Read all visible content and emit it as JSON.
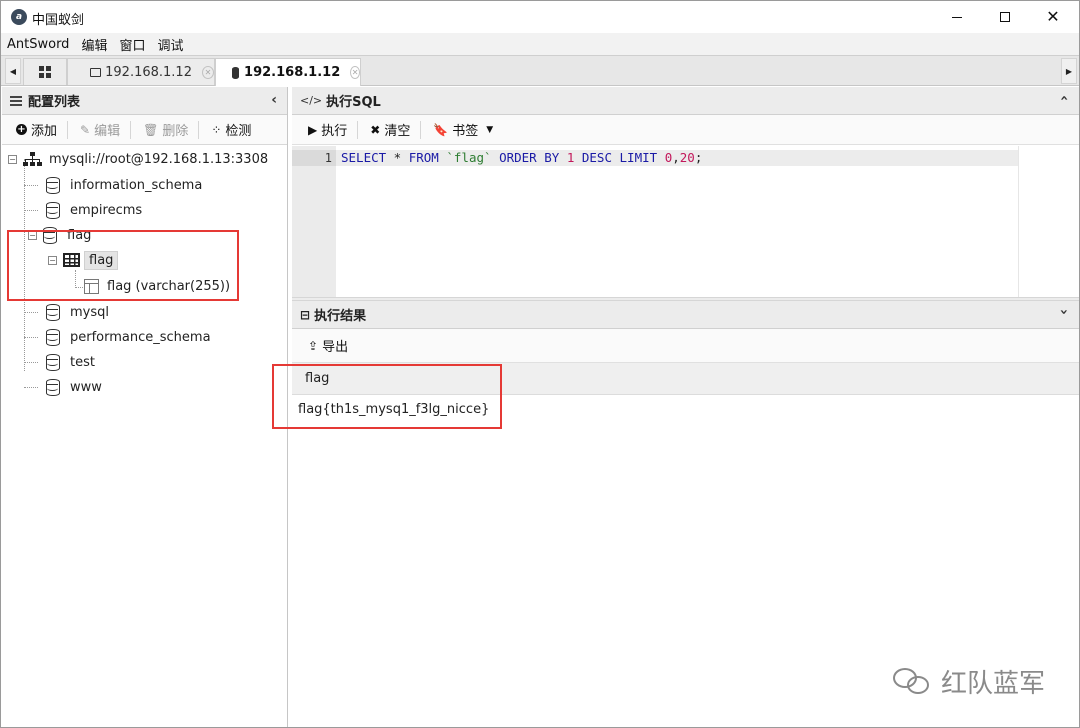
{
  "window": {
    "title": "中国蚁剑"
  },
  "menu": [
    "AntSword",
    "编辑",
    "窗口",
    "调试"
  ],
  "tabs": [
    {
      "label": "192.168.1.12"
    },
    {
      "label": "192.168.1.12"
    }
  ],
  "left": {
    "header": "配置列表",
    "toolbar": {
      "add": "添加",
      "edit": "编辑",
      "delete": "删除",
      "test": "检测"
    },
    "tree": {
      "connection": "mysqli://root@192.168.1.13:3308",
      "databases": [
        "information_schema",
        "empirecms",
        "flag",
        "mysql",
        "performance_schema",
        "test",
        "www"
      ],
      "table": "flag",
      "column": "flag (varchar(255))"
    }
  },
  "sql": {
    "header": "执行SQL",
    "toolbar": {
      "run": "执行",
      "clear": "清空",
      "bookmark": "书签"
    },
    "line_number": "1",
    "tokens": {
      "select": "SELECT",
      "star": " * ",
      "from": "FROM",
      "table": "`flag`",
      "order": "ORDER BY",
      "num1": "1",
      "desc": "DESC",
      "limit": "LIMIT",
      "num2": "0",
      "comma": ",",
      "num3": "20",
      "semi": ";"
    }
  },
  "result": {
    "header": "执行结果",
    "export": "导出",
    "columns": [
      "flag"
    ],
    "rows": [
      [
        "flag{th1s_mysq1_f3lg_nicce}"
      ]
    ]
  },
  "watermark": "红队蓝军",
  "colors": {
    "highlight_box": "#e53935",
    "keyword": "#1a1aa6",
    "string": "#2e7d32",
    "number": "#c2185b"
  }
}
